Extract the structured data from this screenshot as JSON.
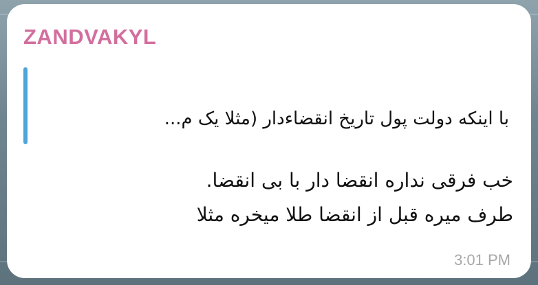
{
  "message": {
    "sender_name": "ZANDVAKYL",
    "reply": {
      "quoted_text": "با اینکه دولت پول تاریخ انقضاءدار (مثلا یک م..."
    },
    "lines": [
      "خب فرقی نداره انقضا دار با بی انقضا.",
      "طرف میره قبل از انقضا طلا میخره مثلا"
    ],
    "time": "3:01 PM"
  },
  "colors": {
    "sender_name": "#d26f9e",
    "reply_bar": "#4da6d9",
    "bubble_background": "#ffffff",
    "timestamp": "#a7a7a7"
  }
}
